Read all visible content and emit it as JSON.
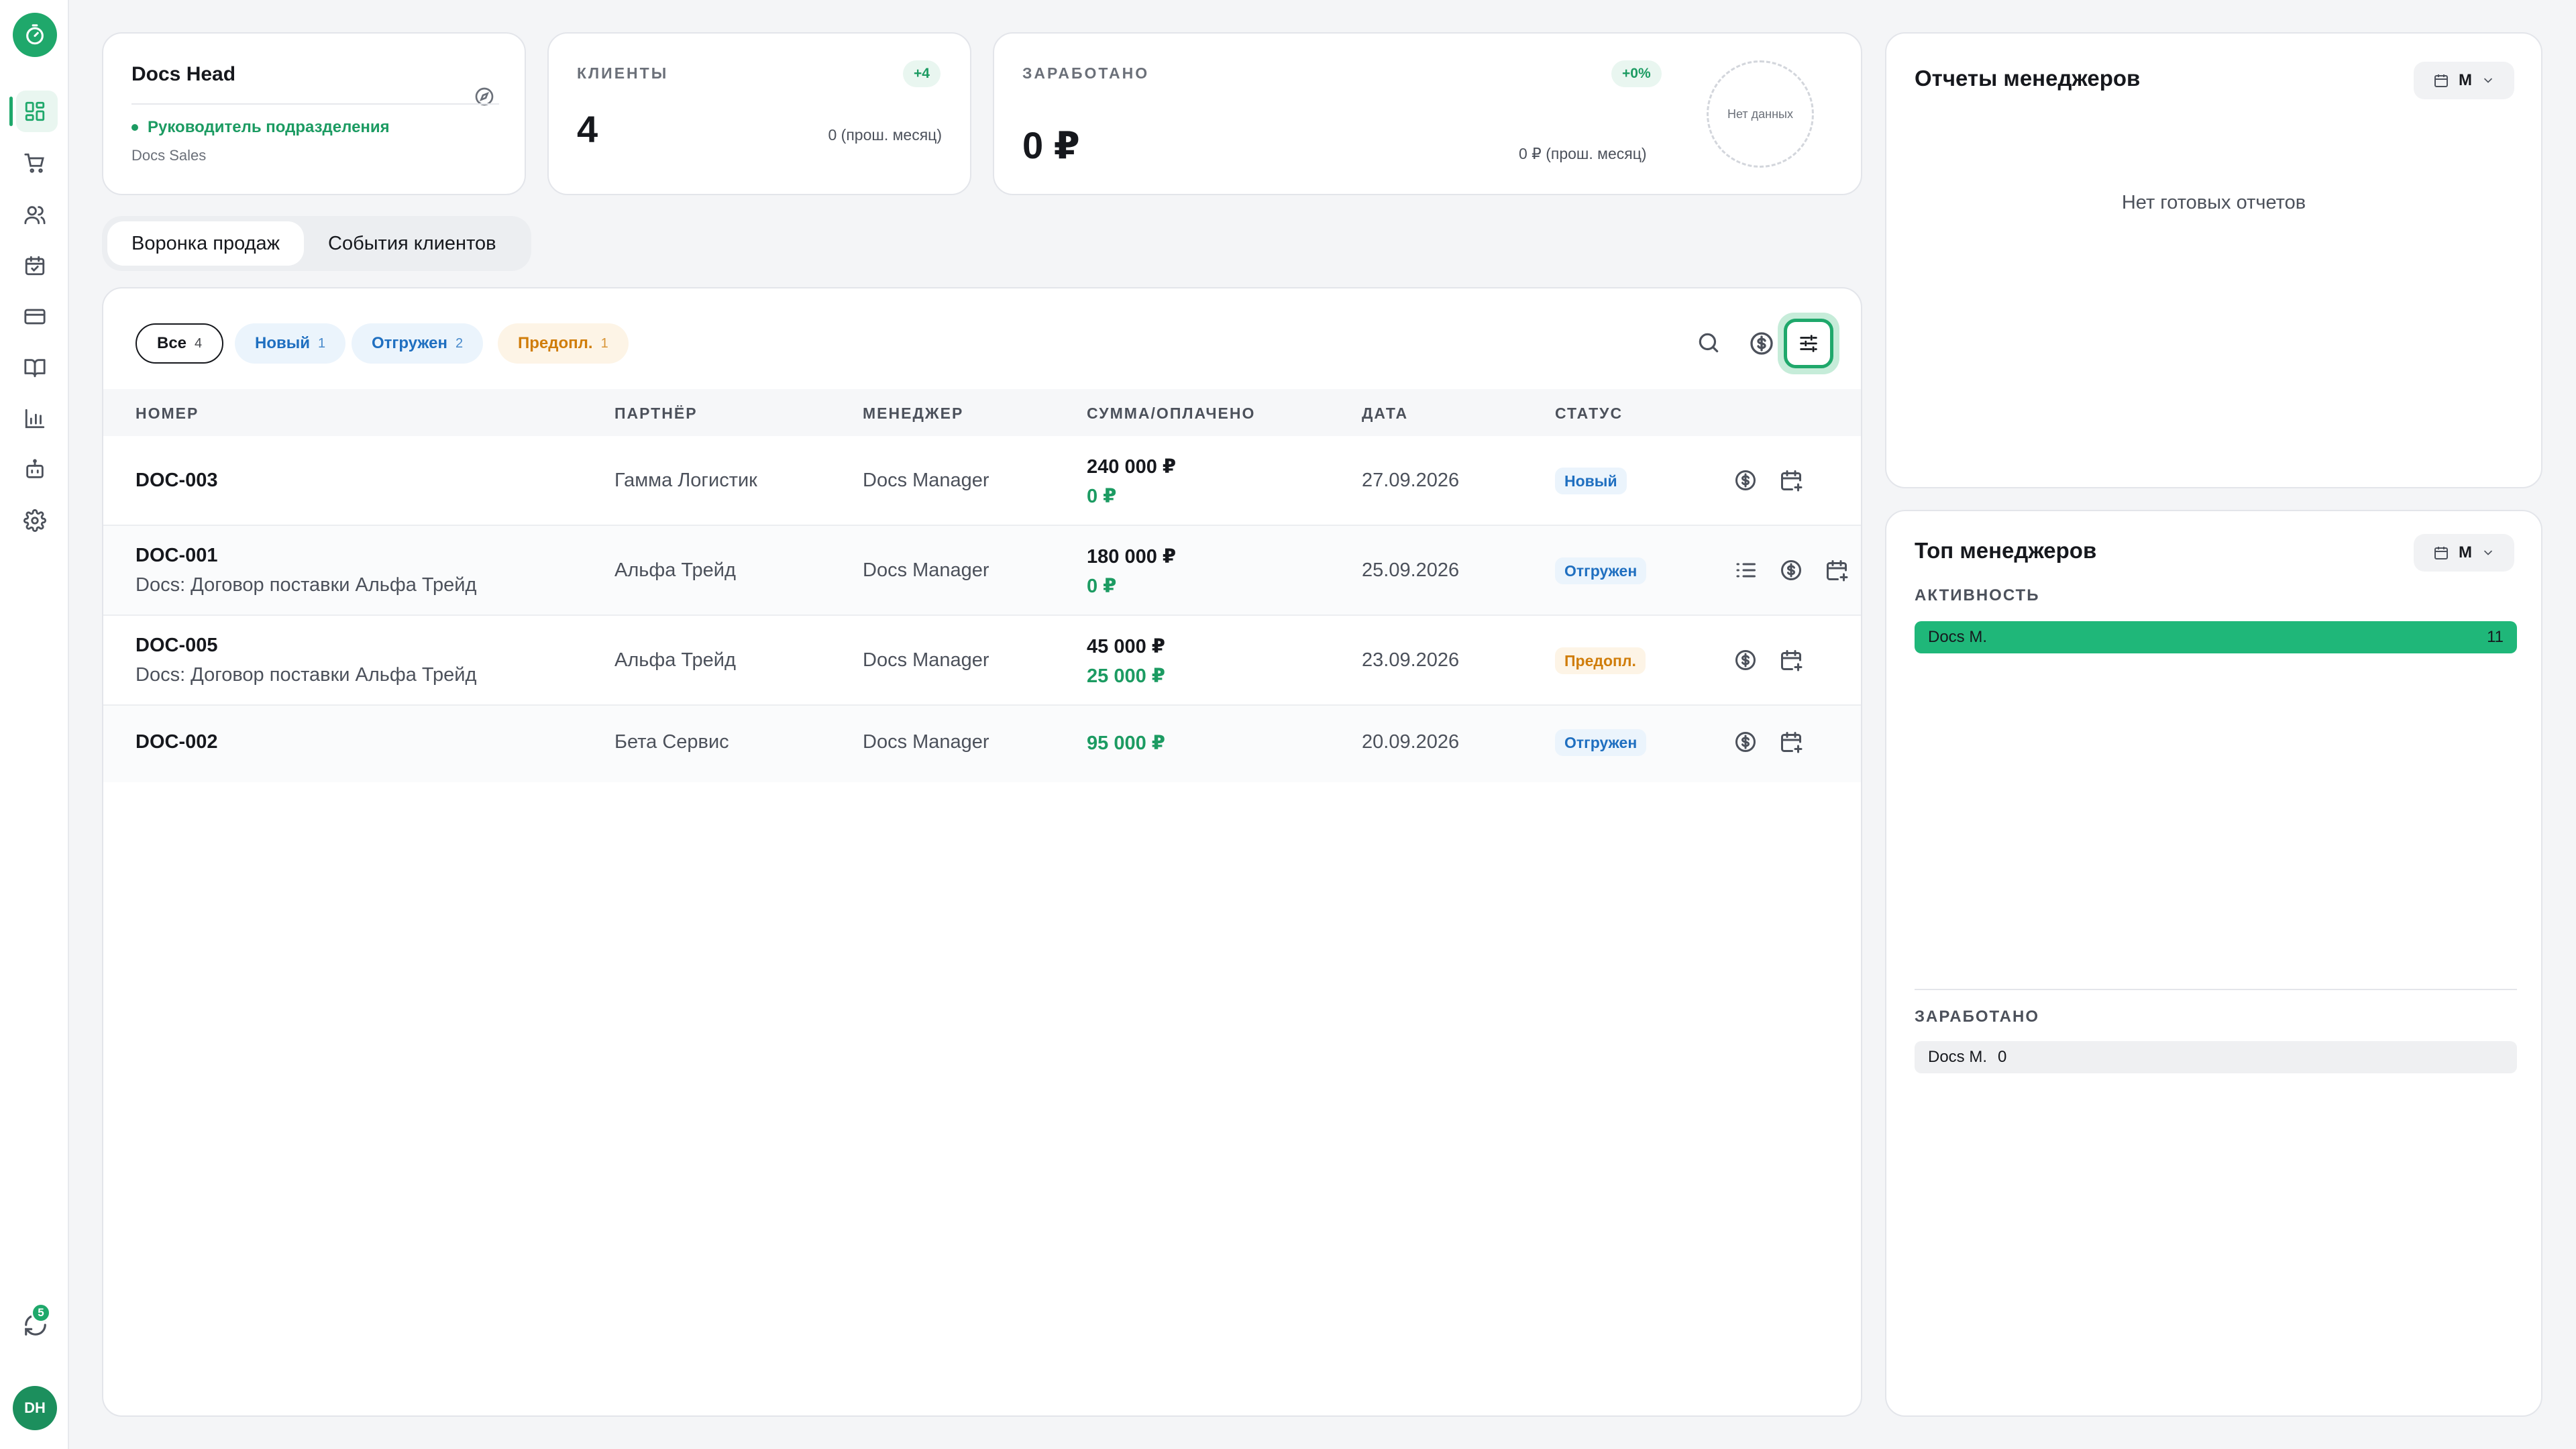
{
  "sidebar": {
    "nav": [
      "dashboard-icon",
      "cart-icon",
      "users-icon",
      "calendar-check-icon",
      "card-icon",
      "book-icon",
      "chart-icon",
      "bot-icon",
      "gear-icon"
    ],
    "sync_badge": "5",
    "avatar_initials": "DH"
  },
  "profile": {
    "title": "Docs Head",
    "role": "Руководитель подразделения",
    "department": "Docs Sales"
  },
  "clients": {
    "label": "КЛИЕНТЫ",
    "delta": "+4",
    "value": "4",
    "previous": "0 (прош. месяц)"
  },
  "earned": {
    "label": "ЗАРАБОТАНО",
    "delta": "+0%",
    "value": "0 ₽",
    "previous": "0 ₽ (прош. месяц)",
    "chart_placeholder": "Нет данных"
  },
  "tabs": [
    {
      "label": "Воронка продаж",
      "active": true
    },
    {
      "label": "События клиентов",
      "active": false
    }
  ],
  "filters": {
    "all": {
      "label": "Все",
      "count": "4"
    },
    "new": {
      "label": "Новый",
      "count": "1"
    },
    "shipped": {
      "label": "Отгружен",
      "count": "2"
    },
    "prepaid": {
      "label": "Предопл.",
      "count": "1"
    }
  },
  "table": {
    "headers": [
      "НОМЕР",
      "ПАРТНЁР",
      "МЕНЕДЖЕР",
      "СУММА/ОПЛАЧЕНО",
      "ДАТА",
      "СТАТУС"
    ],
    "rows": [
      {
        "number": "DOC-003",
        "subtitle": "",
        "partner": "Гамма Логистик",
        "manager": "Docs Manager",
        "amount": "240 000 ₽",
        "paid": "0 ₽",
        "date": "27.09.2026",
        "status": "Новый"
      },
      {
        "number": "DOC-001",
        "subtitle": "Docs: Договор поставки Альфа Трейд",
        "partner": "Альфа Трейд",
        "manager": "Docs Manager",
        "amount": "180 000 ₽",
        "paid": "0 ₽",
        "date": "25.09.2026",
        "status": "Отгружен"
      },
      {
        "number": "DOC-005",
        "subtitle": "Docs: Договор поставки Альфа Трейд",
        "partner": "Альфа Трейд",
        "manager": "Docs Manager",
        "amount": "45 000 ₽",
        "paid": "25 000 ₽",
        "date": "23.09.2026",
        "status": "Предопл."
      },
      {
        "number": "DOC-002",
        "subtitle": "",
        "partner": "Бета Сервис",
        "manager": "Docs Manager",
        "amount": "",
        "paid": "95 000 ₽",
        "date": "20.09.2026",
        "status": "Отгружен"
      }
    ]
  },
  "reports": {
    "title": "Отчеты менеджеров",
    "period": "М",
    "empty": "Нет готовых отчетов"
  },
  "top_managers": {
    "title": "Топ менеджеров",
    "period": "М",
    "activity_label": "АКТИВНОСТЬ",
    "activity": [
      {
        "name": "Docs M.",
        "value": "11"
      }
    ],
    "earned_label": "ЗАРАБОТАНО",
    "earned": [
      {
        "name": "Docs M.",
        "value": "0"
      }
    ]
  },
  "colors": {
    "accent": "#1fa86b",
    "status_blue": "#1f6fc0",
    "status_orange": "#d07d0a"
  }
}
